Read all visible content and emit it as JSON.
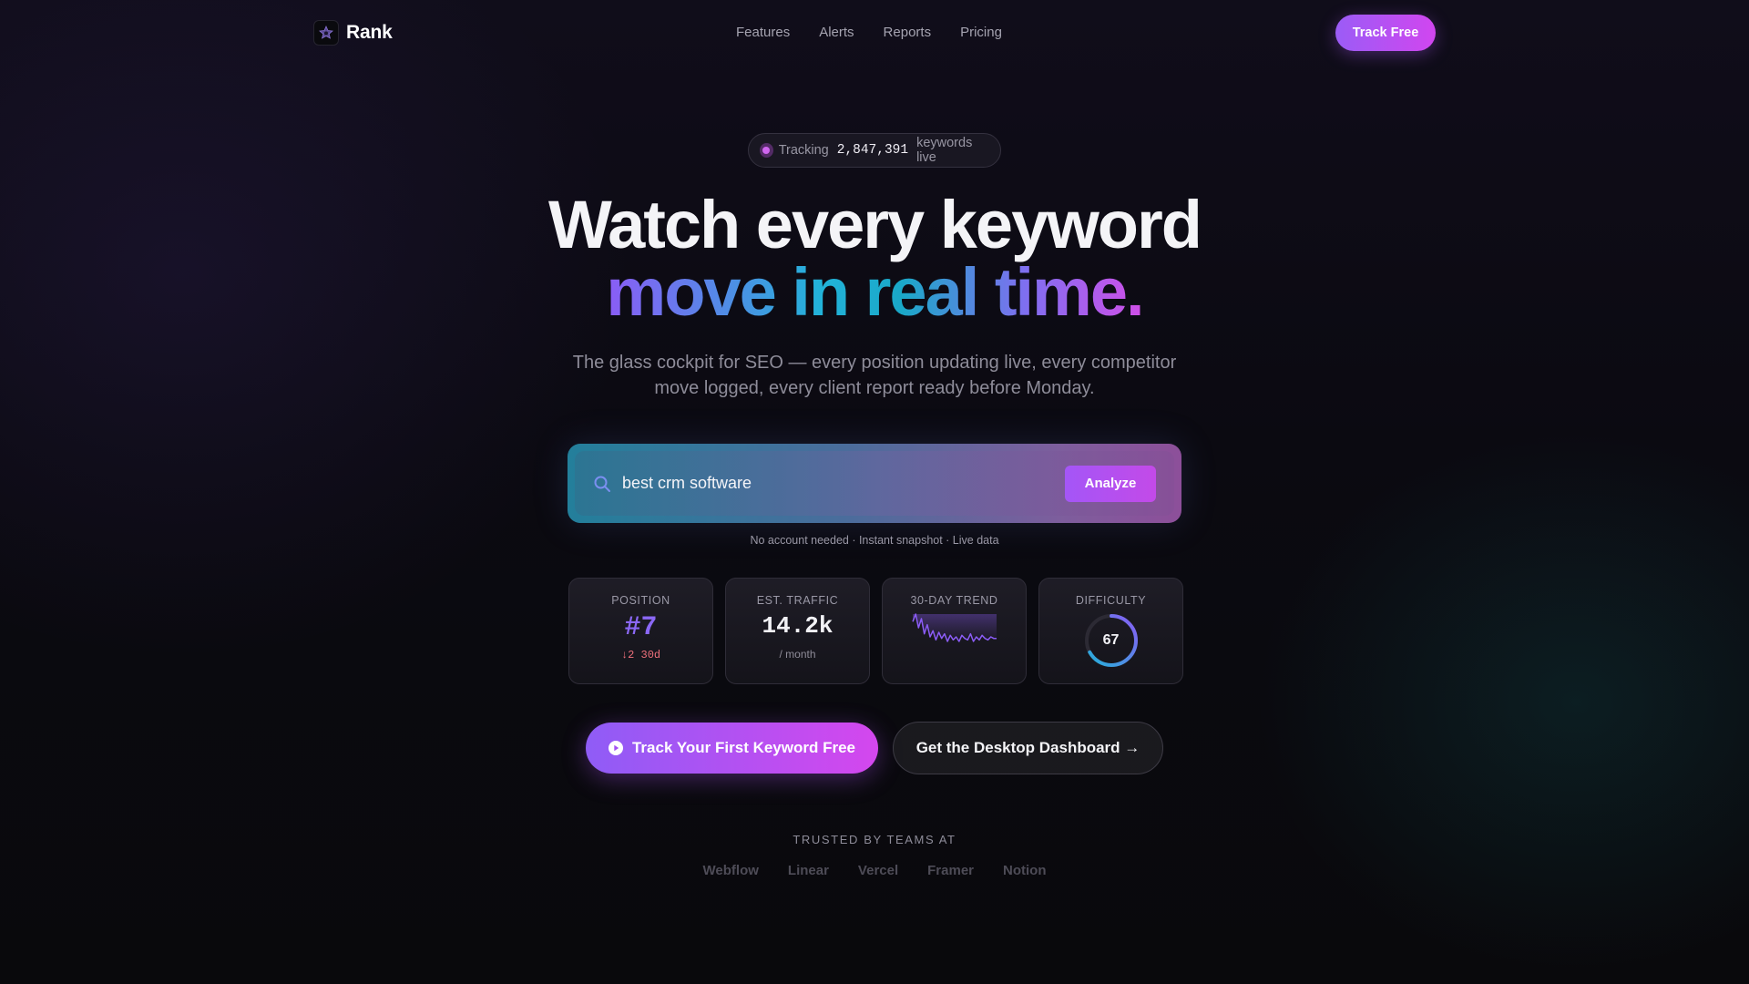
{
  "nav": {
    "brand": "Rank",
    "links": [
      "Features",
      "Alerts",
      "Reports",
      "Pricing"
    ],
    "cta": "Track Free"
  },
  "badge": {
    "prefix": "Tracking",
    "count": "2,847,391",
    "suffix": "keywords live"
  },
  "hero": {
    "line1": "Watch every keyword",
    "line2": "move in real time.",
    "subtitle": "The glass cockpit for SEO — every position updating live, every competitor move logged, every client report ready before Monday."
  },
  "search": {
    "value": "best crm software",
    "button": "Analyze",
    "note": "No account needed · Instant snapshot · Live data"
  },
  "stats": {
    "position": {
      "label": "POSITION",
      "value": "#7",
      "delta": "↓2 30d"
    },
    "traffic": {
      "label": "EST. TRAFFIC",
      "value": "14.2k",
      "unit": "/ month"
    },
    "trend": {
      "label": "30-DAY TREND",
      "points": [
        12,
        7,
        16,
        10,
        20,
        14,
        22,
        18,
        24,
        19,
        23,
        20,
        25,
        21,
        24,
        22,
        25,
        21,
        23,
        24,
        20,
        25,
        22,
        24,
        21,
        23,
        24,
        22,
        23,
        23
      ],
      "color": "#8b5cf6"
    },
    "difficulty": {
      "label": "DIFFICULTY",
      "value": 67,
      "max": 100
    }
  },
  "cta": {
    "primary": "Track Your First Keyword Free",
    "secondary": "Get the Desktop Dashboard →"
  },
  "trusted": {
    "label": "TRUSTED BY TEAMS AT",
    "logos": [
      "Webflow",
      "Linear",
      "Vercel",
      "Framer",
      "Notion"
    ]
  },
  "colors": {
    "accent_start": "#8f5cf6",
    "accent_end": "#d447ee",
    "teal": "#22b3d9",
    "delta_down": "#f0717c"
  }
}
